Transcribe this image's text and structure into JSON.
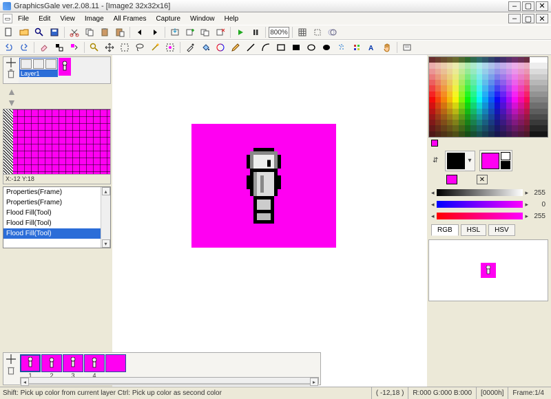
{
  "titlebar": {
    "title": "GraphicsGale ver.2.08.11 - [Image2 32x32x16]"
  },
  "menu": {
    "items": [
      "File",
      "Edit",
      "View",
      "Image",
      "All Frames",
      "Capture",
      "Window",
      "Help"
    ]
  },
  "toolbar1": {
    "zoom": "800%"
  },
  "layers": {
    "label": "Layer1"
  },
  "gridPanel": {
    "coords": "X:-12 Y:18"
  },
  "history": {
    "items": [
      "Properties(Frame)",
      "Properties(Frame)",
      "Flood Fill(Tool)",
      "Flood Fill(Tool)",
      "Flood Fill(Tool)"
    ],
    "selectedIndex": 4
  },
  "sliders": {
    "r_val": "255",
    "g_val": "0",
    "b_val": "255"
  },
  "tabs": {
    "items": [
      "RGB",
      "HSL",
      "HSV"
    ],
    "selected": 0
  },
  "frames": {
    "numbers": [
      "1",
      "2",
      "3",
      "4"
    ]
  },
  "status": {
    "hint": "Shift: Pick up color from current layer  Ctrl: Pick up color as second color",
    "pos": "( -12,18 )",
    "rgb": "R:000 G:000 B:000",
    "hex": "[0000h]",
    "frame": "Frame:1/4"
  },
  "icons": {
    "new": "new",
    "open": "open",
    "search": "search",
    "save": "save",
    "cut": "cut",
    "copy": "copy",
    "paste": "paste",
    "paste2": "paste2",
    "prev": "prev",
    "next": "next",
    "play": "play",
    "pause": "pause",
    "grid": "grid",
    "gridsnap": "gridsnap",
    "eraser": "eraser",
    "swap": "swap",
    "magnify": "magnify",
    "move": "move",
    "marquee": "marquee",
    "lasso": "lasso",
    "wand": "wand",
    "crop": "crop",
    "picker": "picker",
    "bucket": "bucket",
    "hue": "hue",
    "pencil": "pencil",
    "line": "line",
    "rect": "rect",
    "rectfill": "rectfill",
    "circle": "circle",
    "circlefill": "circlefill",
    "spray": "spray",
    "stamp": "stamp",
    "text": "text",
    "hand": "hand",
    "addframe": "addframe",
    "onion": "onion",
    "dots": "dots",
    "opts": "opts"
  }
}
